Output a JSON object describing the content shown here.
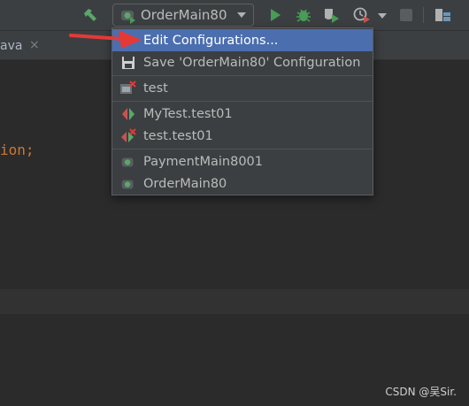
{
  "toolbar": {
    "run_config": "OrderMain80",
    "icons": [
      "hammer-icon",
      "spring-boot-icon",
      "run-icon",
      "debug-icon",
      "coverage-icon",
      "profile-icon",
      "stop-icon",
      "project-structure-icon"
    ]
  },
  "editor": {
    "tab_label": "ava",
    "tab_close": "×",
    "code_fragment": "ion",
    "code_fragment_punct": ";"
  },
  "menu": {
    "items": [
      {
        "label": "Edit Configurations...",
        "icon": "none",
        "selected": true
      },
      {
        "label": "Save 'OrderMain80' Configuration",
        "icon": "save-icon"
      },
      {
        "label": "test",
        "icon": "test-config-error-icon"
      },
      {
        "label": "MyTest.test01",
        "icon": "junit-test-icon"
      },
      {
        "label": "test.test01",
        "icon": "junit-test-error-icon"
      },
      {
        "label": "PaymentMain8001",
        "icon": "spring-boot-icon"
      },
      {
        "label": "OrderMain80",
        "icon": "spring-boot-icon"
      }
    ]
  },
  "annotation": {
    "arrow_color": "#e53935"
  },
  "watermark": "CSDN @吴Sir.",
  "colors": {
    "accent_selection": "#4b6eaf",
    "run_green": "#59a869",
    "error_red": "#e53935"
  }
}
